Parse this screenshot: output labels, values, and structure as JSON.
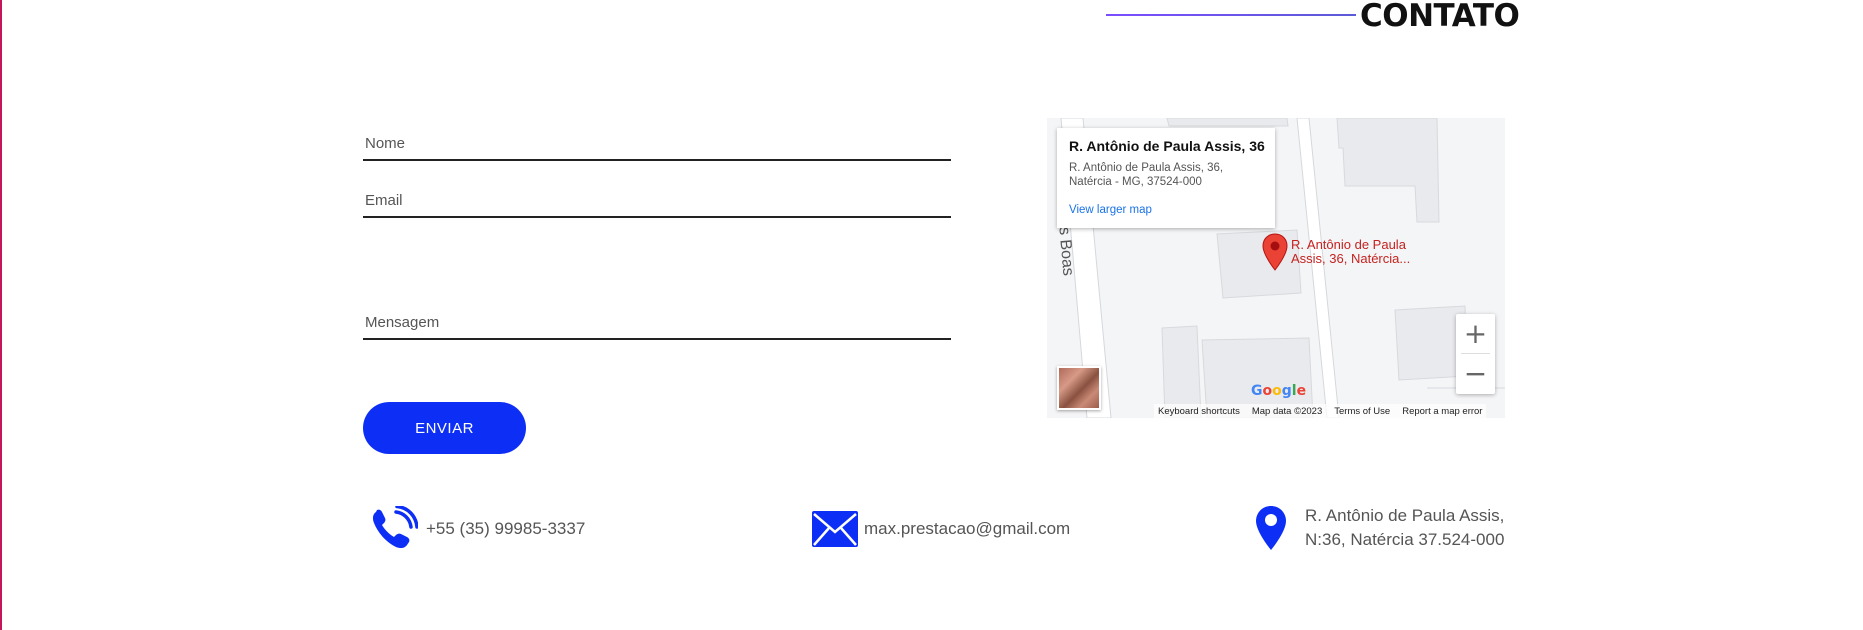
{
  "section": {
    "title": "CONTATO"
  },
  "form": {
    "name_placeholder": "Nome",
    "email_placeholder": "Email",
    "message_placeholder": "Mensagem",
    "submit_label": "ENVIAR"
  },
  "map": {
    "street_label": "Vilas Boas",
    "place_title": "R. Antônio de Paula Assis, 36",
    "place_address": "R. Antônio de Paula Assis, 36, Natércia - MG, 37524-000",
    "view_larger": "View larger map",
    "pin_label": "R. Antônio de Paula Assis, 36, Natércia...",
    "zoom_in": "+",
    "zoom_out": "−",
    "logo": {
      "G": "G",
      "o1": "o",
      "o2": "o",
      "g": "g",
      "l": "l",
      "e": "e"
    },
    "footer": {
      "shortcuts": "Keyboard shortcuts",
      "map_data": "Map data ©2023",
      "terms": "Terms of Use",
      "report": "Report a map error"
    }
  },
  "contact": {
    "phone": "+55 (35) 99985-3337",
    "email": "max.prestacao@gmail.com",
    "address_line1": "R. Antônio de Paula Assis,",
    "address_line2": "N:36, Natércia 37.524-000"
  },
  "colors": {
    "accent": "#0d2ff5",
    "heading_line": "#7c4dff",
    "pin": "#ea4335",
    "link": "#1a73e8"
  }
}
